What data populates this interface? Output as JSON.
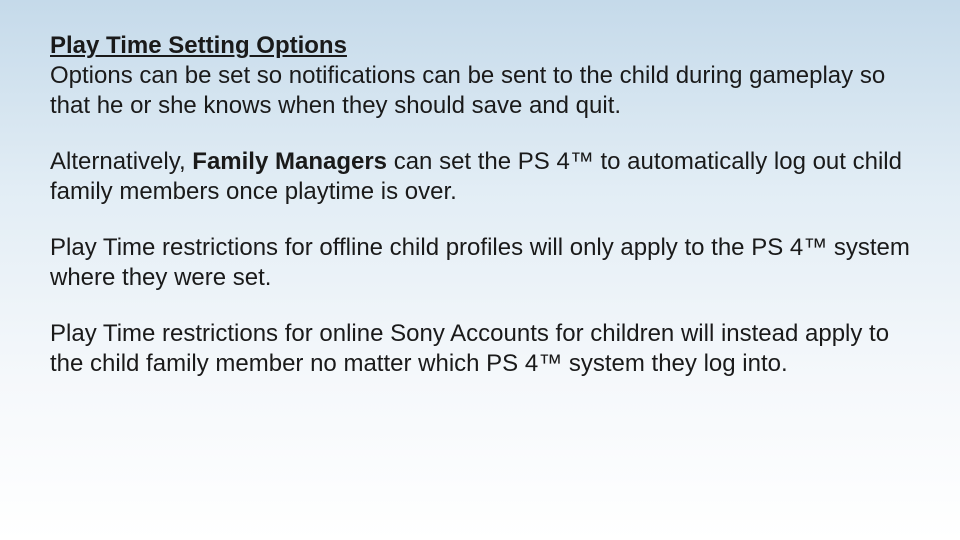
{
  "heading": "Play Time Setting Options",
  "p1": "Options can be set so notifications can be sent to the child during gameplay so that he or she knows when they should save and quit.",
  "p2_before": "Alternatively, ",
  "p2_bold": "Family Managers",
  "p2_after": " can set the PS 4™ to automatically log out child family members once playtime is over.",
  "p3": "Play Time restrictions for offline child profiles will only apply to the PS 4™ system where they were set.",
  "p4": "Play Time restrictions for online Sony Accounts for children will instead apply to the child family member no matter which PS 4™ system they log into."
}
